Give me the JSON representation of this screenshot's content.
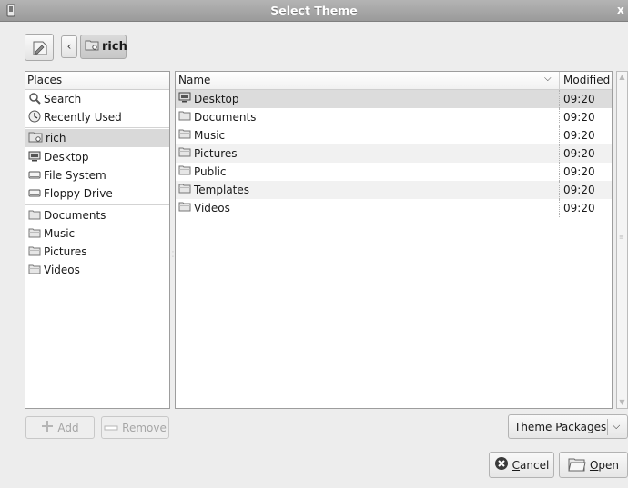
{
  "window": {
    "title": "Select Theme",
    "icon": "window-menu-icon",
    "close_label": "x"
  },
  "toolbar": {
    "edit_icon": "edit-location-icon",
    "back_glyph": "‹",
    "path_button": {
      "label": "rich",
      "icon": "home-folder-icon"
    }
  },
  "places": {
    "header": {
      "mnemonic": "P",
      "rest": "laces"
    },
    "items": [
      {
        "label": "Search",
        "icon": "search-icon",
        "selected": false
      },
      {
        "label": "Recently Used",
        "icon": "recent-icon",
        "selected": false
      },
      {
        "label": "rich",
        "icon": "home-folder-icon",
        "selected": true
      },
      {
        "label": "Desktop",
        "icon": "desktop-icon",
        "selected": false
      },
      {
        "label": "File System",
        "icon": "drive-icon",
        "selected": false
      },
      {
        "label": "Floppy Drive",
        "icon": "floppy-icon",
        "selected": false
      },
      {
        "label": "Documents",
        "icon": "folder-icon",
        "selected": false
      },
      {
        "label": "Music",
        "icon": "folder-icon",
        "selected": false
      },
      {
        "label": "Pictures",
        "icon": "folder-icon",
        "selected": false
      },
      {
        "label": "Videos",
        "icon": "folder-icon",
        "selected": false
      }
    ]
  },
  "files": {
    "columns": {
      "name": "Name",
      "modified": "Modified"
    },
    "rows": [
      {
        "name": "Desktop",
        "icon": "desktop-icon",
        "modified": "09:20",
        "selected": true
      },
      {
        "name": "Documents",
        "icon": "folder-icon",
        "modified": "09:20"
      },
      {
        "name": "Music",
        "icon": "folder-icon",
        "modified": "09:20"
      },
      {
        "name": "Pictures",
        "icon": "folder-icon",
        "modified": "09:20"
      },
      {
        "name": "Public",
        "icon": "folder-icon",
        "modified": "09:20"
      },
      {
        "name": "Templates",
        "icon": "folder-icon",
        "modified": "09:20"
      },
      {
        "name": "Videos",
        "icon": "folder-icon",
        "modified": "09:20"
      }
    ]
  },
  "buttons": {
    "add": {
      "mnemonic": "A",
      "rest": "dd",
      "enabled": false
    },
    "remove": {
      "mnemonic": "R",
      "rest": "emove",
      "enabled": false
    },
    "filter": {
      "label": "Theme Packages"
    },
    "cancel": {
      "mnemonic": "C",
      "rest": "ancel"
    },
    "open": {
      "mnemonic": "O",
      "rest": "pen"
    }
  },
  "colors": {
    "selection": "#d9d9d9",
    "titlebar": "#a8a8a8",
    "dialog_bg": "#ededed"
  }
}
